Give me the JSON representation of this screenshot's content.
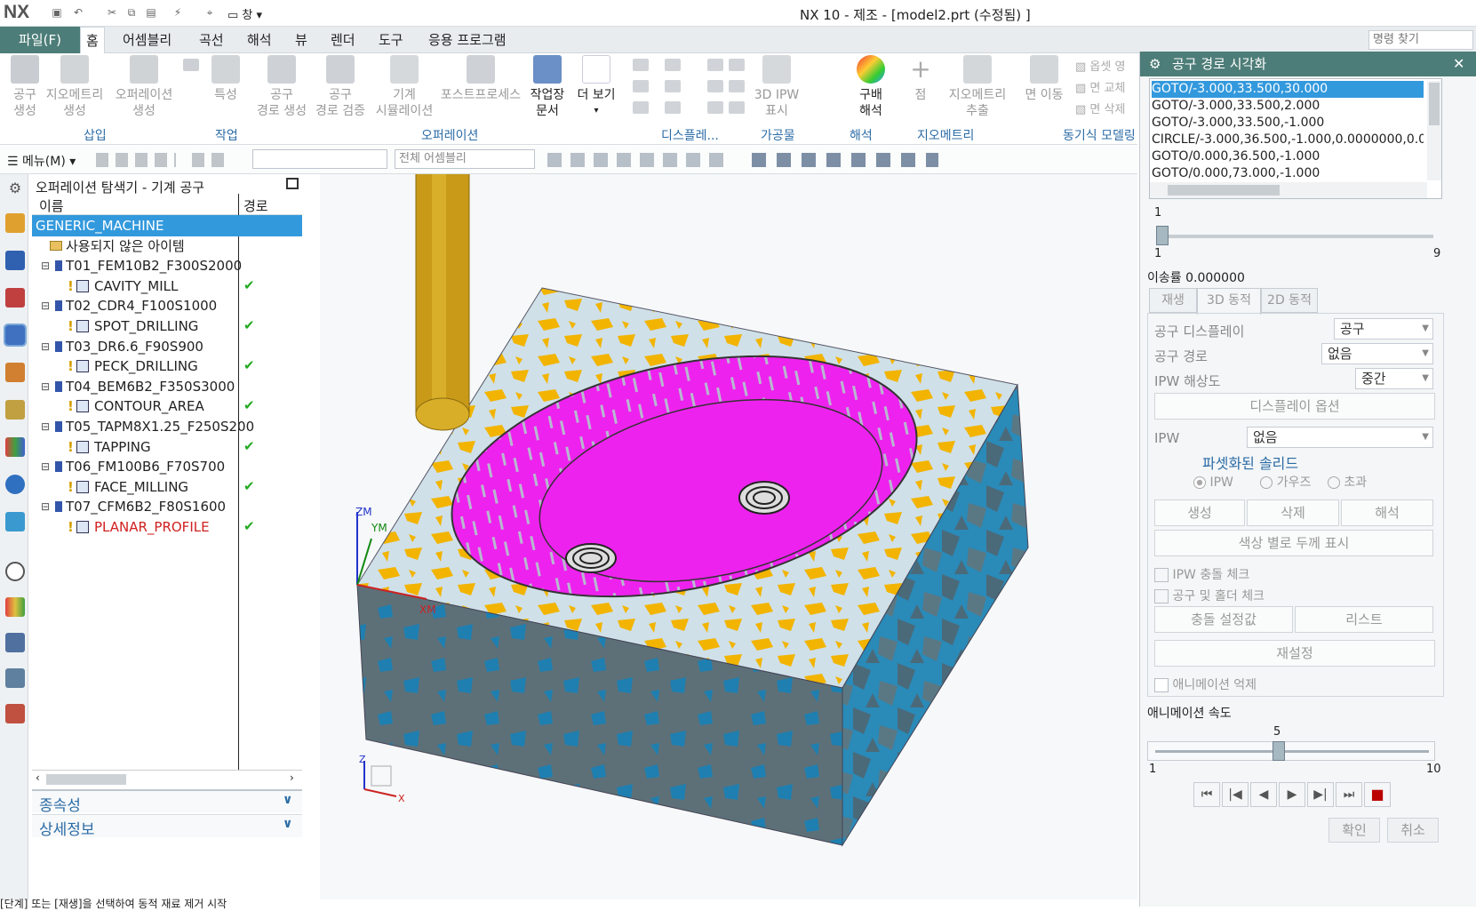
{
  "app": {
    "logo": "NX",
    "window_title": "NX 10 - 제조 - [model2.prt (수정됨) ]",
    "quick_access_window": "창"
  },
  "tabs": {
    "file": "파일(F)",
    "items": [
      "홈",
      "어셈블리",
      "곡선",
      "해석",
      "뷰",
      "렌더",
      "도구",
      "응용 프로그램"
    ],
    "active": "홈"
  },
  "command_finder_placeholder": "명령 찾기",
  "ribbon": {
    "buttons": [
      {
        "label1": "공구",
        "label2": "생성"
      },
      {
        "label1": "지오메트리",
        "label2": "생성"
      },
      {
        "label1": "오퍼레이션",
        "label2": "생성"
      },
      {
        "label1": "특성",
        "label2": ""
      },
      {
        "label1": "공구",
        "label2": "경로 생성"
      },
      {
        "label1": "공구",
        "label2": "경로 검증"
      },
      {
        "label1": "기계",
        "label2": "시뮬레이션"
      },
      {
        "label1": "포스트프로세스",
        "label2": ""
      },
      {
        "label1": "작업장",
        "label2": "문서"
      },
      {
        "label1": "더 보기",
        "label2": ""
      },
      {
        "label1": "3D IPW",
        "label2": "표시"
      },
      {
        "label1": "구배",
        "label2": "해석"
      },
      {
        "label1": "점",
        "label2": ""
      },
      {
        "label1": "지오메트리",
        "label2": "추출"
      },
      {
        "label1": "면 이동",
        "label2": ""
      }
    ],
    "small_buttons": [
      "옵셋 영",
      "면 교체",
      "면 삭제"
    ],
    "groups": [
      "삽입",
      "작업",
      "오퍼레이션",
      "디스플레...",
      "가공물",
      "해석",
      "지오메트리",
      "동기식 모델링"
    ]
  },
  "toolbar2": {
    "menu": "메뉴(M)",
    "filter_combo": "",
    "assembly_combo": "전체 어셈블리"
  },
  "navigator": {
    "title": "오퍼레이션 탐색기 - 기계 공구",
    "col_name": "이름",
    "col_path": "경로",
    "rows": [
      {
        "name": "GENERIC_MACHINE",
        "level": 0,
        "type": "root",
        "check": false
      },
      {
        "name": "사용되지 않은 아이템",
        "level": 1,
        "type": "folder",
        "check": false
      },
      {
        "name": "T01_FEM10B2_F300S2000",
        "level": 1,
        "type": "tool",
        "check": false
      },
      {
        "name": "CAVITY_MILL",
        "level": 2,
        "type": "op",
        "check": true
      },
      {
        "name": "T02_CDR4_F100S1000",
        "level": 1,
        "type": "tool",
        "check": false
      },
      {
        "name": "SPOT_DRILLING",
        "level": 2,
        "type": "op",
        "check": true
      },
      {
        "name": "T03_DR6.6_F90S900",
        "level": 1,
        "type": "tool",
        "check": false
      },
      {
        "name": "PECK_DRILLING",
        "level": 2,
        "type": "op",
        "check": true
      },
      {
        "name": "T04_BEM6B2_F350S3000",
        "level": 1,
        "type": "tool",
        "check": false
      },
      {
        "name": "CONTOUR_AREA",
        "level": 2,
        "type": "op",
        "check": true
      },
      {
        "name": "T05_TAPM8X1.25_F250S200",
        "level": 1,
        "type": "tool",
        "check": false
      },
      {
        "name": "TAPPING",
        "level": 2,
        "type": "op",
        "check": true
      },
      {
        "name": "T06_FM100B6_F70S700",
        "level": 1,
        "type": "tool",
        "check": false
      },
      {
        "name": "FACE_MILLING",
        "level": 2,
        "type": "op",
        "check": true
      },
      {
        "name": "T07_CFM6B2_F80S1600",
        "level": 1,
        "type": "tool",
        "check": false
      },
      {
        "name": "PLANAR_PROFILE",
        "level": 2,
        "type": "op",
        "check": true,
        "red": true
      }
    ],
    "sections": [
      "종속성",
      "상세정보"
    ],
    "checkmark": "✔"
  },
  "viewport": {
    "wcs": {
      "zm": "ZM",
      "ym": "YM",
      "xm": "XM"
    },
    "triad": {
      "z": "Z",
      "x": "X"
    }
  },
  "status": "[단계] 또는 [재생]을 선택하여 동적 재료 제거 시작",
  "dialog": {
    "title": "공구 경로 시각화",
    "path_list": [
      "GOTO/-3.000,33.500,30.000",
      "GOTO/-3.000,33.500,2.000",
      "GOTO/-3.000,33.500,-1.000",
      "CIRCLE/-3.000,36.500,-1.000,0.0000000,0.0000000",
      "GOTO/0.000,36.500,-1.000",
      "GOTO/0.000,73.000,-1.000"
    ],
    "slider1": {
      "current": "1",
      "min": "1",
      "max": "9",
      "value": 1,
      "range": [
        1,
        9
      ]
    },
    "feed_label": "이송률 0.000000",
    "subtabs": [
      "재생",
      "3D 동적",
      "2D 동적"
    ],
    "active_subtab": "3D 동적",
    "tool_display_label": "공구 디스플레이",
    "tool_display_value": "공구",
    "tool_path_label": "공구 경로",
    "tool_path_value": "없음",
    "ipw_res_label": "IPW 해상도",
    "ipw_res_value": "중간",
    "display_options": "디스플레이 옵션",
    "ipw_label": "IPW",
    "ipw_value": "없음",
    "faceted_label": "파셋화된 솔리드",
    "radios": [
      "IPW",
      "가우즈",
      "초과"
    ],
    "btn_row1": [
      "생성",
      "삭제",
      "해석"
    ],
    "color_thick": "색상 별로 두께 표시",
    "chk_ipw_collision": "IPW 충돌 체크",
    "chk_tool_holder": "공구 및 홀더 체크",
    "btn_row2": [
      "충돌 설정값",
      "리스트"
    ],
    "reset": "재설정",
    "chk_anim_suppress": "애니메이션 억제",
    "anim_speed_label": "애니메이션 속도",
    "slider2": {
      "current": "5",
      "min": "1",
      "max": "10",
      "value": 5,
      "range": [
        1,
        10
      ]
    },
    "media": [
      "⏮",
      "|◀",
      "◀",
      "▶",
      "▶|",
      "⏭",
      "■"
    ],
    "ok": "확인",
    "cancel": "취소",
    "close": "✕"
  }
}
